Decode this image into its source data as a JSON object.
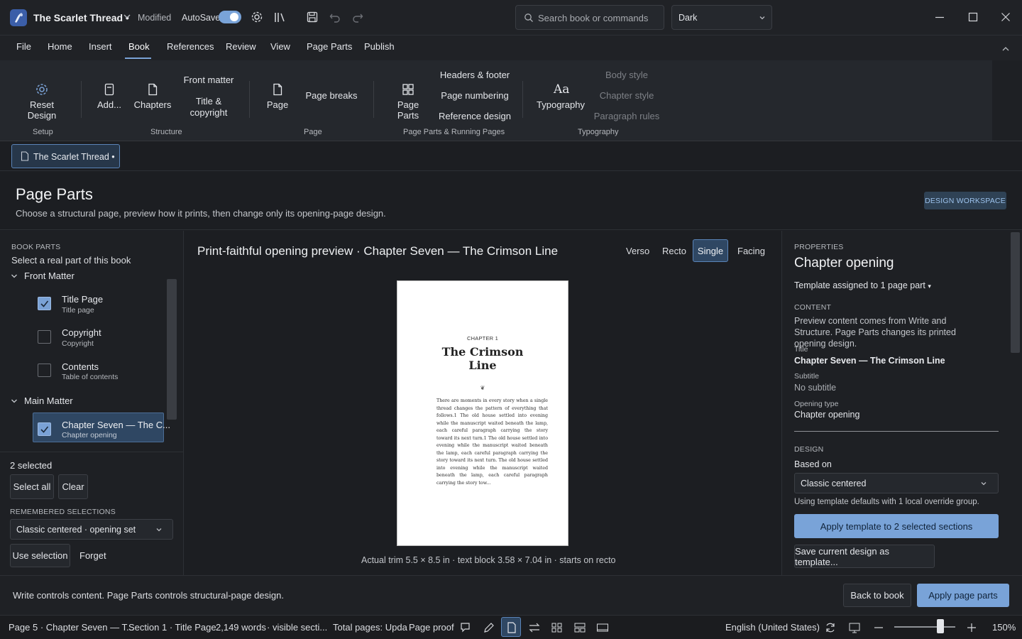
{
  "app": {
    "title": "The Scarlet Thread •",
    "modified": "Modified",
    "autosave": "AutoSave",
    "search_placeholder": "Search book or commands",
    "theme": "Dark"
  },
  "menu": [
    "File",
    "Home",
    "Insert",
    "Book",
    "References",
    "Review",
    "View",
    "Page Parts",
    "Publish"
  ],
  "ribbon": {
    "reset_design": "Reset Design",
    "add": "Add...",
    "chapters": "Chapters",
    "front_matter": "Front matter",
    "title_copyright": "Title & copyright",
    "page": "Page",
    "page_breaks": "Page breaks",
    "page_parts": "Page Parts",
    "headers_footer": "Headers & footer",
    "page_numbering": "Page numbering",
    "reference_design": "Reference design",
    "typography": "Typography",
    "body_style": "Body style",
    "chapter_style": "Chapter style",
    "paragraph_rules": "Paragraph rules",
    "groups": {
      "setup": "Setup",
      "structure": "Structure",
      "page": "Page",
      "page_parts_running": "Page Parts & Running Pages",
      "typography": "Typography"
    }
  },
  "doc_tab": "The Scarlet Thread •",
  "header": {
    "title": "Page Parts",
    "subtitle": "Choose a structural page, preview how it prints, then change only its opening-page design.",
    "workspace_badge": "DESIGN WORKSPACE"
  },
  "left": {
    "section_label": "BOOK PARTS",
    "hint": "Select a real part of this book",
    "front_matter": "Front Matter",
    "main_matter": "Main Matter",
    "items": [
      {
        "title": "Title Page",
        "sub": "Title page",
        "checked": true
      },
      {
        "title": "Copyright",
        "sub": "Copyright",
        "checked": false
      },
      {
        "title": "Contents",
        "sub": "Table of contents",
        "checked": false
      },
      {
        "title": "Chapter Seven — The C...",
        "sub": "Chapter opening",
        "checked": true
      }
    ],
    "selected_count": "2 selected",
    "select_all": "Select all",
    "clear": "Clear",
    "remembered_label": "REMEMBERED SELECTIONS",
    "remembered_value": "Classic centered · opening set",
    "use_selection": "Use selection",
    "forget": "Forget"
  },
  "center": {
    "title": "Print-faithful opening preview · Chapter Seven — The Crimson Line",
    "views": [
      "Verso",
      "Recto",
      "Single",
      "Facing"
    ],
    "active_view": "Single",
    "page": {
      "chapter_label": "CHAPTER 1",
      "title_line1": "The Crimson",
      "title_line2": "Line",
      "ornament": "❦",
      "body": "There are moments in every story when a single thread changes the pattern of everything that follows.1 The old house settled into evening while the manuscript waited beneath the lamp, each careful paragraph carrying the story toward its next turn.1 The old house settled into evening while the manuscript waited beneath the lamp, each careful paragraph carrying the story toward its next turn. The old house settled into evening while the manuscript waited beneath the lamp, each careful paragraph carrying the story tow..."
    },
    "trim_info": "Actual trim 5.5 × 8.5 in · text block 3.58 × 7.04 in · starts on recto"
  },
  "right": {
    "properties_label": "PROPERTIES",
    "heading": "Chapter opening",
    "assigned": "Template assigned to 1 page part",
    "content_label": "CONTENT",
    "content_note": "Preview content comes from Write and Structure. Page Parts changes its printed opening design.",
    "title_label": "Title",
    "title_value": "Chapter Seven — The Crimson Line",
    "subtitle_label": "Subtitle",
    "subtitle_value": "No subtitle",
    "opening_label": "Opening type",
    "opening_value": "Chapter opening",
    "design_label": "DESIGN",
    "based_on_label": "Based on",
    "based_on_value": "Classic centered",
    "defaults_note": "Using template defaults with 1 local override group.",
    "apply_template": "Apply template to 2 selected sections",
    "save_template": "Save current design as template..."
  },
  "footer": {
    "note": "Write controls content. Page Parts controls structural-page design.",
    "back": "Back to book",
    "apply": "Apply page parts"
  },
  "status": {
    "page": "Page 5 · Chapter Seven — T...",
    "section": "Section 1 · Title Page",
    "words": "2,149 words",
    "visible": "· visible secti...",
    "total_pages": "Total pages: Upda",
    "proof": "Page proof",
    "language": "English (United States)",
    "zoom": "150%"
  },
  "colors": {
    "accent": "#7aa2d6",
    "apply_bg": "#79a3d8",
    "badge_bg": "#2f4255"
  }
}
